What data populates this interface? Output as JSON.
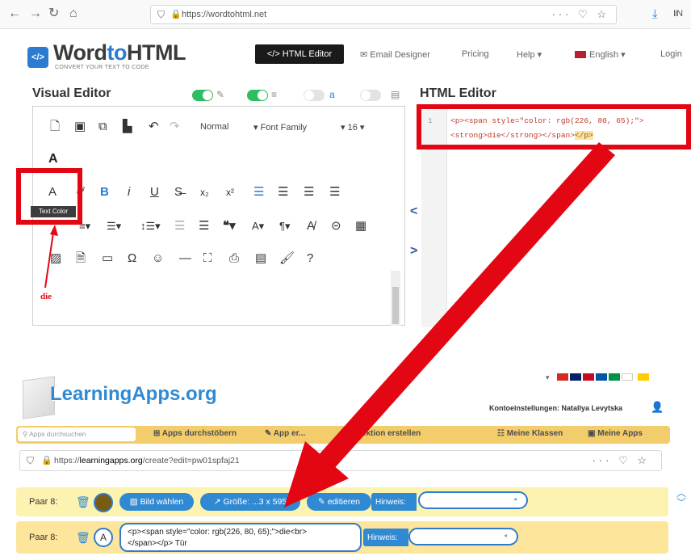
{
  "browser1": {
    "url": "https://wordtohtml.net",
    "right_icons": "··· ♡ ☆",
    "download_icon": "⤓",
    "library_icon": "IIN"
  },
  "wordtohtml": {
    "logo_word": "Word",
    "logo_to": "to",
    "logo_html": "HTML",
    "logo_tagline": "CONVERT YOUR TEXT TO CODE",
    "nav": {
      "html_editor": "</> HTML Editor",
      "email_designer": "Email Designer",
      "pricing": "Pricing",
      "help": "Help ▾",
      "english": "English ▾",
      "login": "Login"
    }
  },
  "visual_editor": {
    "title": "Visual Editor",
    "toolbar": {
      "format": "Normal",
      "font_family": "▾ Font Family",
      "font_size": "▾ 16 ▾",
      "tooltip": "Text Color"
    },
    "content_text": "die"
  },
  "html_editor": {
    "title": "HTML Editor",
    "line_number": "1",
    "line1_a": "<p><span style=\"color: rgb(226, 80, 65);\">",
    "line2_a": "<strong>die</strong></span>",
    "line2_b": "</p>"
  },
  "learningapps": {
    "logo": "LearningApps.org",
    "account": "Kontoeinstellungen: Natallya Levytska",
    "search_placeholder": "Apps durchsuchen",
    "nav": {
      "browse": "Apps durchstöbern",
      "create": "App er...",
      "collection": "...llektion erstellen",
      "classes": "Meine Klassen",
      "my_apps": "Meine Apps"
    },
    "url": {
      "prefix": "https://",
      "domain": "learningapps.org",
      "path": "/create?edit=pw01spfaj21"
    },
    "rows": [
      {
        "label": "Paar 8:",
        "btn_image": "Bild wählen",
        "btn_size": "Größe: ...3 x 595",
        "btn_edit": "editieren",
        "hint": "Hinweis:"
      },
      {
        "label": "Paar 8:",
        "letter": "A",
        "code_line1": "<p><span style=\"color: rgb(226, 80, 65);\">die<br>",
        "code_line2": "</span></p> Tür",
        "hint": "Hinweis:"
      }
    ]
  },
  "annotation": {
    "handwritten": "die",
    "color": "#e30613"
  }
}
